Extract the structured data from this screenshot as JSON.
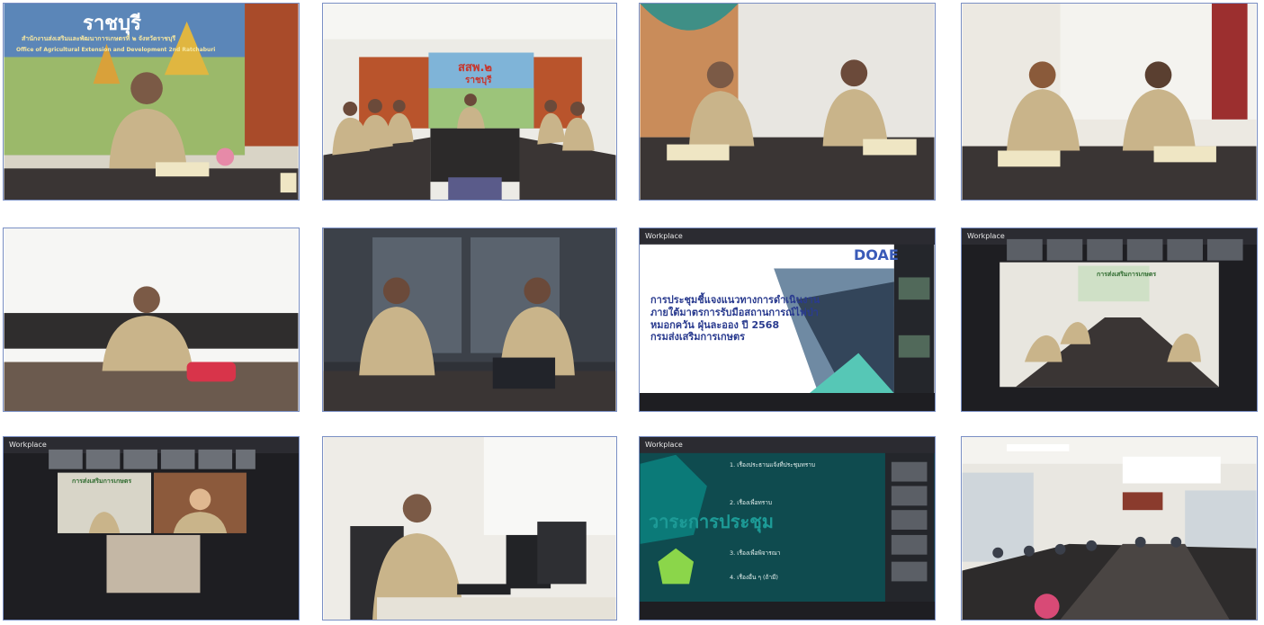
{
  "collage": {
    "photo1": {
      "sign_title": "ราชบุรี",
      "sign_subtitle": "สำนักงานส่งเสริมและพัฒนาการเกษตรที่ ๒ จังหวัดราชบุรี",
      "sign_english": "Office of Agricultural Extension and Development 2nd Ratchaburi"
    },
    "photo2": {
      "banner_title": "สสพ.๒",
      "banner_subtitle": "ราชบุรี"
    },
    "photo7": {
      "app_name": "Workplace",
      "org_logo": "DOAE",
      "slide_title_lines": [
        "การประชุมชี้แจงแนวทางการดำเนินงาน",
        "ภายใต้มาตรการรับมือสถานการณ์ไฟป่า",
        "หมอกควัน ฝุ่นละออง ปี 2568",
        "กรมส่งเสริมการเกษตร"
      ]
    },
    "photo8": {
      "app_name": "Workplace",
      "room_sign": "การส่งเสริมการเกษตร"
    },
    "photo9": {
      "app_name": "Workplace",
      "room_sign": "การส่งเสริมการเกษตร"
    },
    "photo11": {
      "app_name": "Workplace",
      "agenda_title": "วาระการประชุม",
      "agenda_items": [
        "1. เรื่องประธานแจ้งที่ประชุมทราบ",
        "2. เรื่องเพื่อทราบ",
        "3. เรื่องเพื่อพิจารณา",
        "4. เรื่องอื่น ๆ (ถ้ามี)"
      ]
    }
  },
  "colors": {
    "uniform": "#c9b48a",
    "desk": "#3a3534",
    "wall": "#eae6dc",
    "zoom_dark": "#1e1e22",
    "agenda_bg": "#0f4b4f",
    "agenda_accent": "#8bd64a",
    "border": "#7a8fc4"
  }
}
